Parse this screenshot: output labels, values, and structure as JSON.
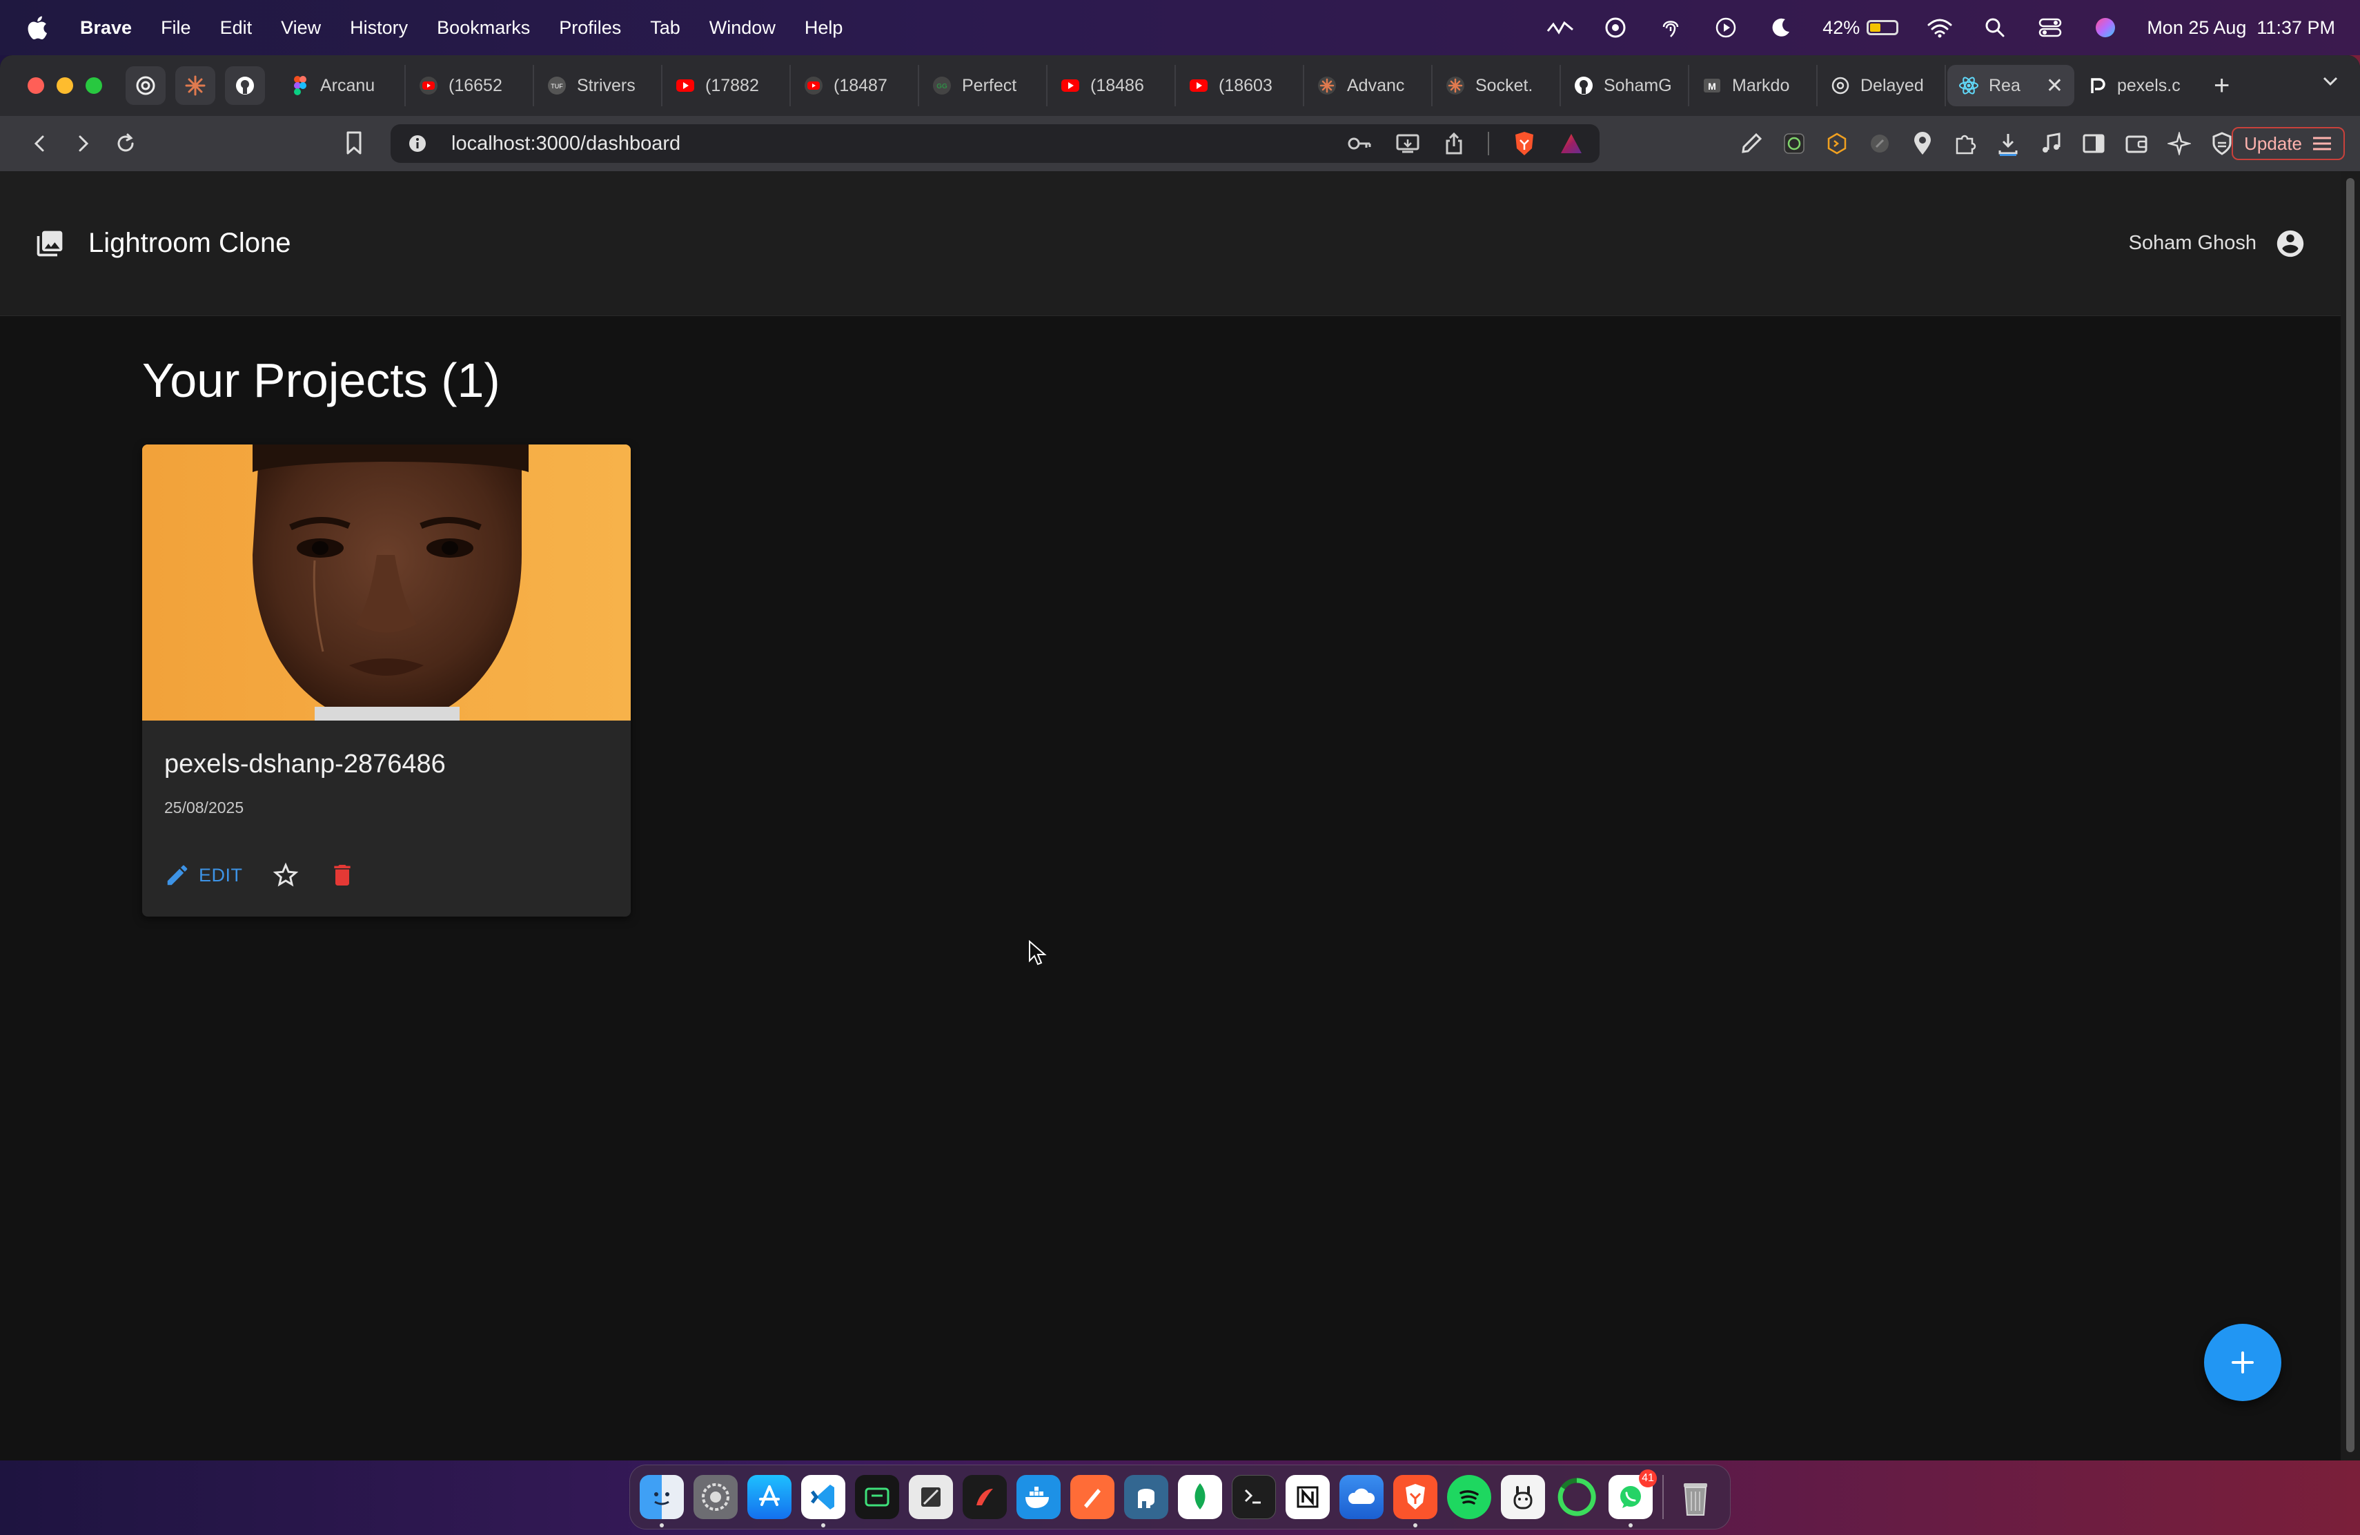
{
  "menubar": {
    "app_name": "Brave",
    "items": [
      "File",
      "Edit",
      "View",
      "History",
      "Bookmarks",
      "Profiles",
      "Tab",
      "Window",
      "Help"
    ],
    "battery_percent": "42%",
    "battery_level": 0.42,
    "clock": "Mon 25 Aug  11:37 PM"
  },
  "tabs": [
    {
      "label": "Arcanu",
      "icon": "figma-icon"
    },
    {
      "label": "(16652",
      "icon": "youtube-icon"
    },
    {
      "label": "Strivers",
      "icon": "tuf-icon"
    },
    {
      "label": "(17882",
      "icon": "youtube-icon"
    },
    {
      "label": "(18487",
      "icon": "youtube-icon"
    },
    {
      "label": "Perfect",
      "icon": "gfg-icon"
    },
    {
      "label": "(18486",
      "icon": "youtube-icon"
    },
    {
      "label": "(18603",
      "icon": "youtube-icon"
    },
    {
      "label": "Advanc",
      "icon": "claude-icon"
    },
    {
      "label": "Socket.",
      "icon": "claude-icon"
    },
    {
      "label": "SohamG",
      "icon": "github-icon"
    },
    {
      "label": "Markdo",
      "icon": "markdown-icon"
    },
    {
      "label": "Delayed",
      "icon": "chatgpt-icon"
    },
    {
      "label": "Rea",
      "icon": "react-icon",
      "active": true
    },
    {
      "label": "pexels.c",
      "icon": "pexels-icon"
    }
  ],
  "browser": {
    "url": "localhost:3000/dashboard",
    "update_label": "Update"
  },
  "app": {
    "brand": "Lightroom Clone",
    "user_name": "Soham Ghosh"
  },
  "main": {
    "title": "Your Projects (1)",
    "projects": [
      {
        "name": "pexels-dshanp-2876486",
        "date": "25/08/2025",
        "edit_label": "EDIT"
      }
    ]
  },
  "colors": {
    "accent": "#2196f3",
    "delete": "#e53935",
    "thumbnail_bg": "#f3a93f"
  },
  "dock": [
    {
      "name": "finder"
    },
    {
      "name": "system-settings"
    },
    {
      "name": "app-store"
    },
    {
      "name": "vscode"
    },
    {
      "name": "terminal-green"
    },
    {
      "name": "preview"
    },
    {
      "name": "hoppscotch"
    },
    {
      "name": "docker"
    },
    {
      "name": "postman"
    },
    {
      "name": "pgadmin"
    },
    {
      "name": "mongodb-compass"
    },
    {
      "name": "terminal"
    },
    {
      "name": "notion"
    },
    {
      "name": "proxyman"
    },
    {
      "name": "brave"
    },
    {
      "name": "spotify"
    },
    {
      "name": "ollama"
    },
    {
      "name": "activity-ring"
    },
    {
      "name": "whatsapp",
      "badge": "41"
    },
    {
      "name": "trash"
    }
  ]
}
